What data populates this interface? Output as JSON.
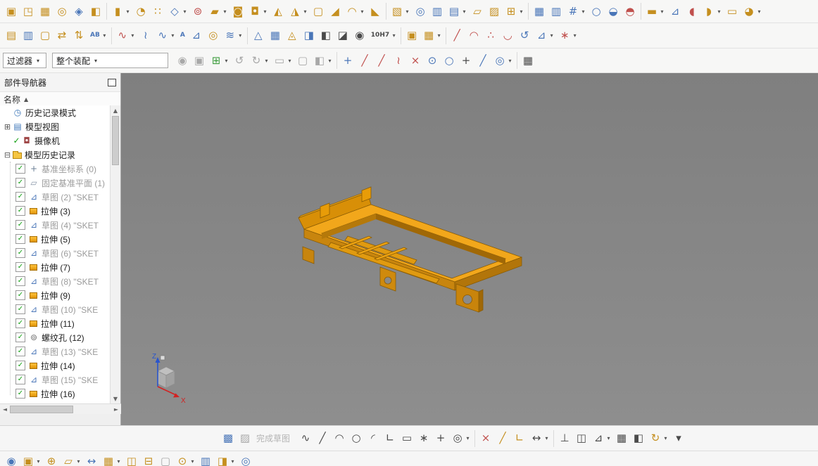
{
  "filters": {
    "type_filter": "过滤器",
    "scope_filter": "整个装配"
  },
  "navigator": {
    "title": "部件导航器",
    "header": "名称",
    "sort_arrow": "▲",
    "top_items": [
      {
        "name": "tree-item-history-mode",
        "label": "历史记录模式",
        "icon": "clock",
        "exp": ""
      },
      {
        "name": "tree-item-model-views",
        "label": "模型视图",
        "icon": "views",
        "exp": "+"
      },
      {
        "name": "tree-item-cameras",
        "label": "摄像机",
        "icon": "camera",
        "exp": "",
        "check": true
      },
      {
        "name": "tree-item-model-history",
        "label": "模型历史记录",
        "icon": "folder",
        "exp": "-"
      }
    ],
    "history_items": [
      {
        "label": "基准坐标系 (0)",
        "icon": "csys",
        "gray": true
      },
      {
        "label": "固定基准平面 (1)",
        "icon": "plane",
        "gray": true
      },
      {
        "label": "草图 (2) \"SKET",
        "icon": "sketch",
        "gray": true
      },
      {
        "label": "拉伸 (3)",
        "icon": "extrude",
        "gray": false
      },
      {
        "label": "草图 (4) \"SKET",
        "icon": "sketch",
        "gray": true
      },
      {
        "label": "拉伸 (5)",
        "icon": "extrude",
        "gray": false
      },
      {
        "label": "草图 (6) \"SKET",
        "icon": "sketch",
        "gray": true
      },
      {
        "label": "拉伸 (7)",
        "icon": "extrude",
        "gray": false
      },
      {
        "label": "草图 (8) \"SKET",
        "icon": "sketch",
        "gray": true
      },
      {
        "label": "拉伸 (9)",
        "icon": "extrude",
        "gray": false
      },
      {
        "label": "草图 (10) \"SKE",
        "icon": "sketch",
        "gray": true
      },
      {
        "label": "拉伸 (11)",
        "icon": "extrude",
        "gray": false
      },
      {
        "label": "螺纹孔 (12)",
        "icon": "hole",
        "gray": false
      },
      {
        "label": "草图 (13) \"SKE",
        "icon": "sketch",
        "gray": true
      },
      {
        "label": "拉伸 (14)",
        "icon": "extrude",
        "gray": false
      },
      {
        "label": "草图 (15) \"SKE",
        "icon": "sketch",
        "gray": true
      },
      {
        "label": "拉伸 (16)",
        "icon": "extrude",
        "gray": false
      }
    ]
  },
  "toolbars": {
    "row1": [
      {
        "n": "init-project-icon",
        "g": "▣",
        "c": "G"
      },
      {
        "n": "mold-csys-icon",
        "g": "◳",
        "c": "G"
      },
      {
        "n": "shrinkage-icon",
        "g": "▦",
        "c": "G"
      },
      {
        "n": "workpiece-icon",
        "g": "◎",
        "c": "G"
      },
      {
        "n": "cavity-layout-icon",
        "g": "◈",
        "c": "B"
      },
      {
        "n": "parting-tools-icon",
        "g": "◧",
        "c": "G"
      },
      {
        "n": "extrude-icon",
        "g": "▮",
        "c": "G",
        "dd": 1,
        "sp": 1
      },
      {
        "n": "revolve-icon",
        "g": "◔",
        "c": "G"
      },
      {
        "n": "pattern-feature-icon",
        "g": "∷",
        "c": "G"
      },
      {
        "n": "datum-plane-icon",
        "g": "◇",
        "c": "B",
        "dd": 1
      },
      {
        "n": "hole-icon",
        "g": "⊚",
        "c": "R"
      },
      {
        "n": "rib-icon",
        "g": "▰",
        "c": "G",
        "dd": 1
      },
      {
        "n": "unite-icon",
        "g": "◙",
        "c": "G"
      },
      {
        "n": "subtract-icon",
        "g": "◘",
        "c": "G",
        "dd": 1
      },
      {
        "n": "trim-body-icon",
        "g": "◭",
        "c": "G"
      },
      {
        "n": "split-body-icon",
        "g": "◮",
        "c": "G",
        "dd": 1
      },
      {
        "n": "shell-icon",
        "g": "▢",
        "c": "G"
      },
      {
        "n": "chamfer-icon",
        "g": "◢",
        "c": "G"
      },
      {
        "n": "edge-blend-icon",
        "g": "◠",
        "c": "G",
        "dd": 1
      },
      {
        "n": "draft-icon",
        "g": "◣",
        "c": "G"
      },
      {
        "n": "swept-icon",
        "g": "▧",
        "c": "G",
        "dd": 1,
        "sp": 1
      },
      {
        "n": "tube-icon",
        "g": "◎",
        "c": "B"
      },
      {
        "n": "ruled-surface-icon",
        "g": "▥",
        "c": "B"
      },
      {
        "n": "through-curves-icon",
        "g": "▤",
        "c": "B",
        "dd": 1
      },
      {
        "n": "bounded-plane-icon",
        "g": "▱",
        "c": "G"
      },
      {
        "n": "thicken-icon",
        "g": "▨",
        "c": "G"
      },
      {
        "n": "sew-icon",
        "g": "⊞",
        "c": "G",
        "dd": 1
      },
      {
        "n": "curve-mesh-icon",
        "g": "▦",
        "c": "B",
        "sp": 1
      },
      {
        "n": "studio-surface-icon",
        "g": "▥",
        "c": "B"
      },
      {
        "n": "surface-grid-icon",
        "g": "#",
        "c": "B",
        "dd": 1
      },
      {
        "n": "sphere-surface-icon",
        "g": "○",
        "c": "B"
      },
      {
        "n": "deform-surface-icon",
        "g": "◒",
        "c": "B"
      },
      {
        "n": "xform-icon",
        "g": "◓",
        "c": "R"
      },
      {
        "n": "pad-group-icon",
        "g": "▬",
        "c": "G",
        "dd": 1,
        "sp": 1
      },
      {
        "n": "sketch-curve-icon",
        "g": "⊿",
        "c": "B"
      },
      {
        "n": "patch-icon",
        "g": "◖",
        "c": "R"
      },
      {
        "n": "offset-surface-icon",
        "g": "◗",
        "c": "G",
        "dd": 1
      },
      {
        "n": "bridge-surface-icon",
        "g": "▭",
        "c": "G"
      },
      {
        "n": "freeform-more-icon",
        "g": "◕",
        "c": "G",
        "dd": 1
      }
    ],
    "row2": [
      {
        "n": "view-layers-icon",
        "g": "▤",
        "c": "G"
      },
      {
        "n": "layer-settings-icon",
        "g": "▥",
        "c": "B"
      },
      {
        "n": "sheet-icon",
        "g": "▢",
        "c": "G"
      },
      {
        "n": "transform-icon",
        "g": "⇄",
        "c": "G"
      },
      {
        "n": "move-object-icon",
        "g": "⇅",
        "c": "G"
      },
      {
        "n": "measure-icon",
        "g": "AB",
        "c": "B",
        "txt": 1,
        "dd": 1
      },
      {
        "n": "studio-spline-icon",
        "g": "∿",
        "c": "R",
        "dd": 1,
        "sp": 1
      },
      {
        "n": "curve-icon",
        "g": "≀",
        "c": "B"
      },
      {
        "n": "helix-icon",
        "g": "∿",
        "c": "B",
        "dd": 1
      },
      {
        "n": "text-icon",
        "g": "A",
        "c": "B",
        "txt": 1
      },
      {
        "n": "pen-icon",
        "g": "⊿",
        "c": "B"
      },
      {
        "n": "torus-icon",
        "g": "◎",
        "c": "G"
      },
      {
        "n": "wave-curve-icon",
        "g": "≋",
        "c": "B",
        "dd": 1
      },
      {
        "n": "datum-triangle-icon",
        "g": "△",
        "c": "B",
        "sp": 1
      },
      {
        "n": "table-annotation-icon",
        "g": "▦",
        "c": "B"
      },
      {
        "n": "pmi-icon",
        "g": "◬",
        "c": "G"
      },
      {
        "n": "view-boundary-icon",
        "g": "◨",
        "c": "B"
      },
      {
        "n": "section-view-icon",
        "g": "◧",
        "c": "D"
      },
      {
        "n": "display-style-icon",
        "g": "◪",
        "c": "D"
      },
      {
        "n": "binoculars-icon",
        "g": "◉",
        "c": "D"
      },
      {
        "n": "tolerance-icon",
        "g": "10H7",
        "c": "D",
        "txt": 1,
        "dd": 1
      },
      {
        "n": "add-assembly-icon",
        "g": "▣",
        "c": "G",
        "sp": 1
      },
      {
        "n": "assembly-pattern-icon",
        "g": "▦",
        "c": "G",
        "dd": 1
      },
      {
        "n": "line-icon",
        "g": "╱",
        "c": "R",
        "sp": 1
      },
      {
        "n": "arc-icon",
        "g": "◠",
        "c": "R"
      },
      {
        "n": "point-set-icon",
        "g": "∴",
        "c": "R"
      },
      {
        "n": "conic-icon",
        "g": "◡",
        "c": "R"
      },
      {
        "n": "rotate-curve-icon",
        "g": "↺",
        "c": "B"
      },
      {
        "n": "spline-edit-icon",
        "g": "⊿",
        "c": "B",
        "dd": 1
      },
      {
        "n": "curve-analysis-icon",
        "g": "∗",
        "c": "R",
        "dd": 1
      }
    ],
    "row3": [
      {
        "n": "show-hide-icon",
        "g": "◉",
        "c": "Gy"
      },
      {
        "n": "immersive-icon",
        "g": "▣",
        "c": "Gy"
      },
      {
        "n": "snap-plus-icon",
        "g": "⊞",
        "c": "Gn",
        "dd": 1
      },
      {
        "n": "undo-icon",
        "g": "↺",
        "c": "Gy"
      },
      {
        "n": "redo-icon",
        "g": "↻",
        "c": "Gy",
        "dd": 1
      },
      {
        "n": "rectangle-select-icon",
        "g": "▭",
        "c": "Gy",
        "dd": 1
      },
      {
        "n": "shaded-view-icon",
        "g": "▢",
        "c": "Gy"
      },
      {
        "n": "wireframe-view-icon",
        "g": "◧",
        "c": "Gy",
        "dd": 1
      },
      {
        "n": "snap-enable-icon",
        "g": "+",
        "c": "B",
        "sp": 1
      },
      {
        "n": "snap-endpoint-icon",
        "g": "╱",
        "c": "R"
      },
      {
        "n": "snap-midpoint-icon",
        "g": "╱",
        "c": "R"
      },
      {
        "n": "snap-control-point-icon",
        "g": "≀",
        "c": "R"
      },
      {
        "n": "snap-intersection-icon",
        "g": "×",
        "c": "R"
      },
      {
        "n": "snap-arc-center-icon",
        "g": "⊙",
        "c": "B"
      },
      {
        "n": "snap-quadrant-icon",
        "g": "○",
        "c": "B"
      },
      {
        "n": "snap-existing-point-icon",
        "g": "+",
        "c": "D"
      },
      {
        "n": "snap-point-on-curve-icon",
        "g": "╱",
        "c": "B"
      },
      {
        "n": "snap-point-on-face-icon",
        "g": "◎",
        "c": "B",
        "dd": 1
      },
      {
        "n": "grid-table-icon",
        "g": "▦",
        "c": "D",
        "sp": 1
      }
    ],
    "sketch_lead": [
      {
        "n": "open-sketch-env-icon",
        "g": "▩",
        "c": "B"
      },
      {
        "n": "finish-flag-icon",
        "g": "▨",
        "c": "Gy"
      }
    ],
    "sketch": [
      {
        "n": "profile-icon",
        "g": "∿",
        "c": "D"
      },
      {
        "n": "sketch-line-icon",
        "g": "╱",
        "c": "D"
      },
      {
        "n": "sketch-arc-icon",
        "g": "◠",
        "c": "D"
      },
      {
        "n": "sketch-circle-icon",
        "g": "○",
        "c": "D"
      },
      {
        "n": "fillet-icon",
        "g": "◜",
        "c": "D"
      },
      {
        "n": "sketch-chamfer-icon",
        "g": "∟",
        "c": "D"
      },
      {
        "n": "rectangle-icon",
        "g": "▭",
        "c": "D"
      },
      {
        "n": "polygon-icon",
        "g": "∗",
        "c": "D"
      },
      {
        "n": "point-icon",
        "g": "+",
        "c": "D"
      },
      {
        "n": "offset-curve-icon",
        "g": "◎",
        "c": "D",
        "dd": 1
      },
      {
        "n": "quick-trim-icon",
        "g": "×",
        "c": "R",
        "sp": 1
      },
      {
        "n": "quick-extend-icon",
        "g": "╱",
        "c": "G"
      },
      {
        "n": "make-corner-icon",
        "g": "∟",
        "c": "G"
      },
      {
        "n": "dimension-icon",
        "g": "↔",
        "c": "D",
        "dd": 1
      },
      {
        "n": "geometric-constraints-icon",
        "g": "⊥",
        "c": "D",
        "sp": 1
      },
      {
        "n": "set-symmetric-icon",
        "g": "◫",
        "c": "D"
      },
      {
        "n": "constraint-more-icon",
        "g": "⊿",
        "c": "D",
        "dd": 1
      },
      {
        "n": "pattern-curve-icon",
        "g": "▦",
        "c": "D"
      },
      {
        "n": "mirror-curve-icon",
        "g": "◧",
        "c": "D"
      },
      {
        "n": "show-constraints-icon",
        "g": "↻",
        "c": "G",
        "dd": 1
      },
      {
        "n": "sketch-overflow-icon",
        "g": "▾",
        "c": "D"
      }
    ],
    "bottom": [
      {
        "n": "explode-view-icon",
        "g": "◉",
        "c": "B"
      },
      {
        "n": "assembly-sequence-icon",
        "g": "▣",
        "c": "G",
        "dd": 1
      },
      {
        "n": "add-component-icon",
        "g": "⊕",
        "c": "G"
      },
      {
        "n": "new-component-icon",
        "g": "▱",
        "c": "G",
        "dd": 1
      },
      {
        "n": "move-component-icon",
        "g": "↔",
        "c": "B"
      },
      {
        "n": "pattern-component-icon",
        "g": "▦",
        "c": "G",
        "dd": 1
      },
      {
        "n": "mirror-assembly-icon",
        "g": "◫",
        "c": "G"
      },
      {
        "n": "suppress-component-icon",
        "g": "⊟",
        "c": "G"
      },
      {
        "n": "arrangements-icon",
        "g": "▢",
        "c": "Gy"
      },
      {
        "n": "assembly-constraints-icon",
        "g": "⊙",
        "c": "G",
        "dd": 1
      },
      {
        "n": "wave-linker-icon",
        "g": "▥",
        "c": "B"
      },
      {
        "n": "sequence-icon",
        "g": "◨",
        "c": "G",
        "dd": 1
      },
      {
        "n": "clearance-analysis-icon",
        "g": "◎",
        "c": "B"
      }
    ]
  },
  "sketch_toolbar": {
    "finish_label": "完成草图"
  },
  "viewport": {
    "model_color": "#f2a71b",
    "background": "#868686",
    "triad": {
      "z_label": "Z",
      "x_label": "X"
    }
  },
  "scrollbar": {
    "up": "▲",
    "down": "▼",
    "left": "◄",
    "right": "►"
  }
}
